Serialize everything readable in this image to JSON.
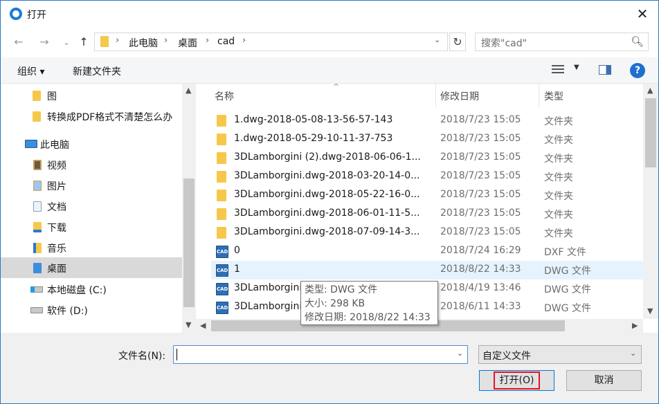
{
  "window": {
    "title": "打开",
    "close_glyph": "✕"
  },
  "nav": {
    "back_glyph": "←",
    "forward_glyph": "→",
    "recent_glyph": "⌄",
    "up_glyph": "↑",
    "breadcrumb": [
      "此电脑",
      "桌面",
      "cad"
    ],
    "crumb_sep": "›",
    "refresh_glyph": "↻",
    "search_placeholder": "搜索\"cad\"",
    "search_icon": "search-icon"
  },
  "toolbar": {
    "organize": "组织 ▾",
    "new_folder": "新建文件夹",
    "view_dd": "▼",
    "help": "?"
  },
  "sidebar": {
    "items": [
      {
        "label": "图",
        "icon": "folder-icon"
      },
      {
        "label": "转换成PDF格式不清楚怎么办",
        "icon": "folder-icon"
      },
      {
        "label": "此电脑",
        "icon": "computer-icon"
      },
      {
        "label": "视频",
        "icon": "videos-icon"
      },
      {
        "label": "图片",
        "icon": "pictures-icon"
      },
      {
        "label": "文档",
        "icon": "documents-icon"
      },
      {
        "label": "下载",
        "icon": "downloads-icon"
      },
      {
        "label": "音乐",
        "icon": "music-icon"
      },
      {
        "label": "桌面",
        "icon": "desktop-icon"
      },
      {
        "label": "本地磁盘 (C:)",
        "icon": "drive-c-icon"
      },
      {
        "label": "软件 (D:)",
        "icon": "drive-d-icon"
      }
    ],
    "selected": "桌面"
  },
  "columns": {
    "name": "名称",
    "date": "修改日期",
    "type": "类型",
    "sort_indicator": "^"
  },
  "files": [
    {
      "name": "1.dwg-2018-05-08-13-56-57-143",
      "date": "2018/7/23 15:05",
      "type": "文件夹",
      "kind": "folder"
    },
    {
      "name": "1.dwg-2018-05-29-10-11-37-753",
      "date": "2018/7/23 15:05",
      "type": "文件夹",
      "kind": "folder"
    },
    {
      "name": "3DLamborgini (2).dwg-2018-06-06-1...",
      "date": "2018/7/23 15:05",
      "type": "文件夹",
      "kind": "folder"
    },
    {
      "name": "3DLamborgini.dwg-2018-03-20-14-0...",
      "date": "2018/7/23 15:05",
      "type": "文件夹",
      "kind": "folder"
    },
    {
      "name": "3DLamborgini.dwg-2018-05-22-16-0...",
      "date": "2018/7/23 15:05",
      "type": "文件夹",
      "kind": "folder"
    },
    {
      "name": "3DLamborgini.dwg-2018-06-01-11-5...",
      "date": "2018/7/23 15:05",
      "type": "文件夹",
      "kind": "folder"
    },
    {
      "name": "3DLamborgini.dwg-2018-07-09-14-3...",
      "date": "2018/7/23 15:05",
      "type": "文件夹",
      "kind": "folder"
    },
    {
      "name": "0",
      "date": "2018/7/24 16:29",
      "type": "DXF 文件",
      "kind": "cad"
    },
    {
      "name": "1",
      "date": "2018/8/22 14:33",
      "type": "DWG 文件",
      "kind": "cad"
    },
    {
      "name": "3DLamborgini",
      "date": "2018/4/19 13:46",
      "type": "DWG 文件",
      "kind": "cad"
    },
    {
      "name": "3DLamborgini",
      "date": "2018/6/11 14:33",
      "type": "DWG 文件",
      "kind": "cad"
    }
  ],
  "selected_file": "1",
  "cad_icon_text": "CAD",
  "tooltip": {
    "type": "类型: DWG 文件",
    "size": "大小: 298 KB",
    "modified": "修改日期: 2018/8/22 14:33"
  },
  "footer": {
    "filename_label": "文件名(N):",
    "filename_value": "",
    "filter_value": "自定义文件",
    "open_button": "打开(O)",
    "cancel_button": "取消",
    "dd_glyph": "⌄"
  },
  "colors": {
    "accent": "#0078d7",
    "selection": "#e5f3ff",
    "highlight_box": "#e81123",
    "folder": "#f6c84a"
  }
}
